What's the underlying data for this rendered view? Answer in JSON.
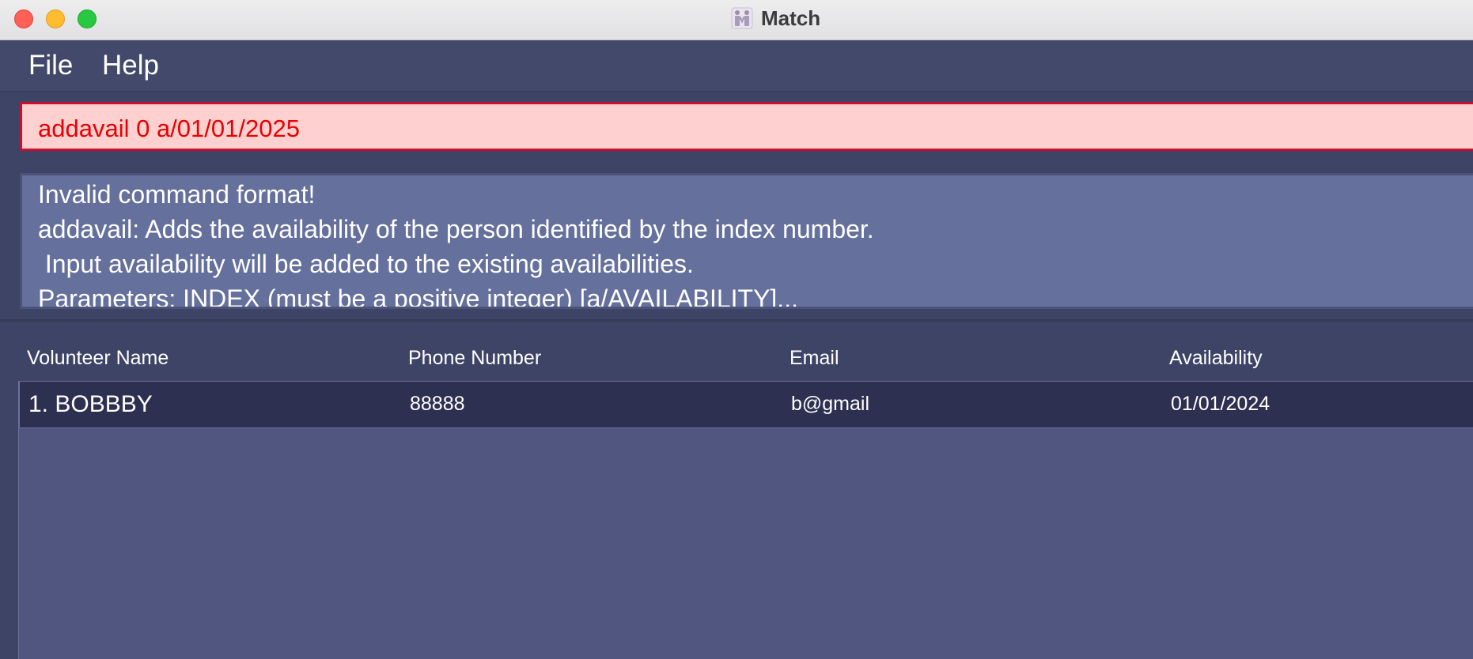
{
  "window": {
    "title": "Match",
    "app_icon": "people-icon"
  },
  "menu": {
    "items": [
      {
        "label": "File"
      },
      {
        "label": "Help"
      }
    ]
  },
  "command": {
    "value": "addavail 0 a/01/01/2025",
    "state": "error",
    "colors": {
      "background": "#ffd0d0",
      "border": "#c8102e",
      "text": "#ea0000"
    }
  },
  "result": {
    "lines": [
      "Invalid command format!",
      "addavail: Adds the availability of the person identified by the index number.",
      " Input availability will be added to the existing availabilities.",
      "Parameters: INDEX (must be a positive integer) [a/AVAILABILITY]..."
    ]
  },
  "table": {
    "columns": [
      "Volunteer Name",
      "Phone Number",
      "Email",
      "Availability"
    ],
    "rows": [
      {
        "name": "1. BOBBBY",
        "phone": "88888",
        "email": "b@gmail",
        "availability": "01/01/2024"
      }
    ]
  },
  "colors": {
    "theme_background": "#3e4466",
    "result_background": "#66709c",
    "list_background": "#50567f",
    "selected_row": "#2d3050"
  }
}
